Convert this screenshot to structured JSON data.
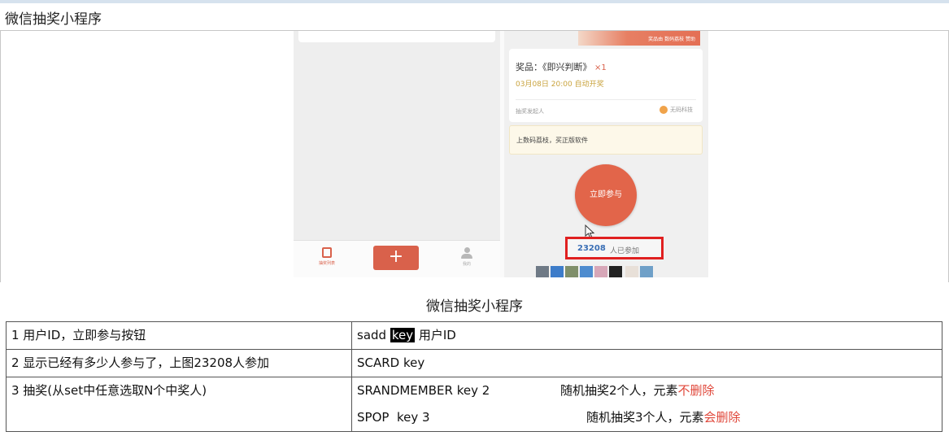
{
  "page": {
    "title": "微信抽奖小程序",
    "caption": "微信抽奖小程序"
  },
  "screenshot_left": {
    "tabbar": {
      "list_label": "抽奖列表",
      "plus_label": "+",
      "me_label": "我的"
    }
  },
  "screenshot_right": {
    "banner_text": "奖品由 数码荔枝 赞助",
    "prize": "奖品：《即兴判断》",
    "prize_multiplier": "×1",
    "draw_time": "03月08日 20:00 自动开奖",
    "initiator_label": "抽奖发起人",
    "sponsor": "无码科技",
    "notice": "上数码荔枝，买正版软件",
    "join_button": "立即参与",
    "participant_count": "23208",
    "participant_label": "人已参加"
  },
  "table": {
    "rows": [
      {
        "left": "1 用户ID，立即参与按钮",
        "cmd_prefix": "sadd ",
        "cmd_key": "key",
        "cmd_suffix": " 用户ID"
      },
      {
        "left": "2 显示已经有多少人参与了，上图23208人参加",
        "cmd": "SCARD key"
      },
      {
        "left": "3 抽奖(从set中任意选取N个中奖人)",
        "cmd1": "SRANDMEMBER key 2",
        "desc1_prefix": "随机抽奖2个人，元素",
        "desc1_red": "不删除",
        "cmd2": "SPOP  key 3",
        "desc2_prefix": "随机抽奖3个人，元素",
        "desc2_red": "会删除"
      }
    ]
  },
  "colors": {
    "accent": "#d9614b",
    "highlight_box": "#e02020",
    "warning_text": "#e0473a"
  }
}
